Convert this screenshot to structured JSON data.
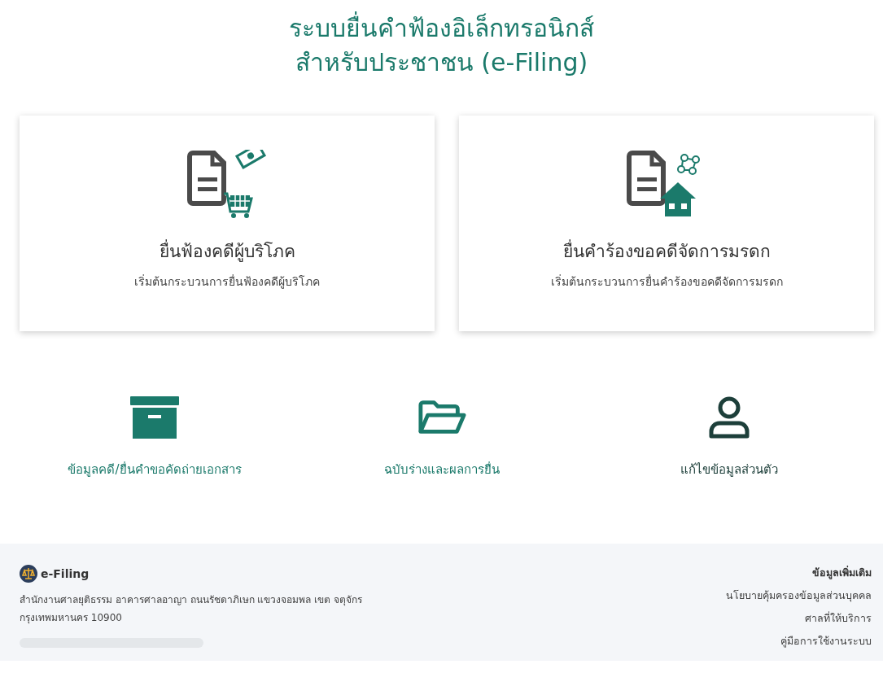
{
  "header": {
    "title_lines": [
      "ระบบยื่นคำฟ้องอิเล็กทรอนิกส์",
      "สำหรับประชาชน (e-Filing)"
    ]
  },
  "services": [
    {
      "kind": "consumer",
      "title": "ยื่นฟ้องคดีผู้บริโภค",
      "subtitle": "เริ่มต้นกระบวนการยื่นฟ้องคดีผู้บริโภค"
    },
    {
      "kind": "estate",
      "title": "ยื่นคำร้องขอคดีจัดการมรดก",
      "subtitle": "เริ่มต้นกระบวนการยื่นคำร้องขอคดีจัดการมรดก"
    }
  ],
  "shortcuts": [
    {
      "kind": "box",
      "label": "ข้อมูลคดี/ยื่นคำขอคัดถ่ายเอกสาร",
      "color": "#1b7a6b"
    },
    {
      "kind": "folder",
      "label": "ฉบับร่างและผลการยื่น",
      "color": "#1b7a6b"
    },
    {
      "kind": "user",
      "label": "แก้ไขข้อมูลส่วนตัว",
      "color": "#1d3f3a"
    }
  ],
  "footer": {
    "brand": "e-Filing",
    "address": "สำนักงานศาลยุติธรรม อาคารศาลอาญา ถนนรัชดาภิเษก แขวงจอมพล เขต จตุจักร กรุงเทพมหานคร 10900",
    "links_title": "ข้อมูลเพิ่มเติม",
    "links": [
      "นโยบายคุ้มครองข้อมูลส่วนบุคคล",
      "ศาลที่ให้บริการ",
      "คู่มือการใช้งานระบบ"
    ]
  }
}
